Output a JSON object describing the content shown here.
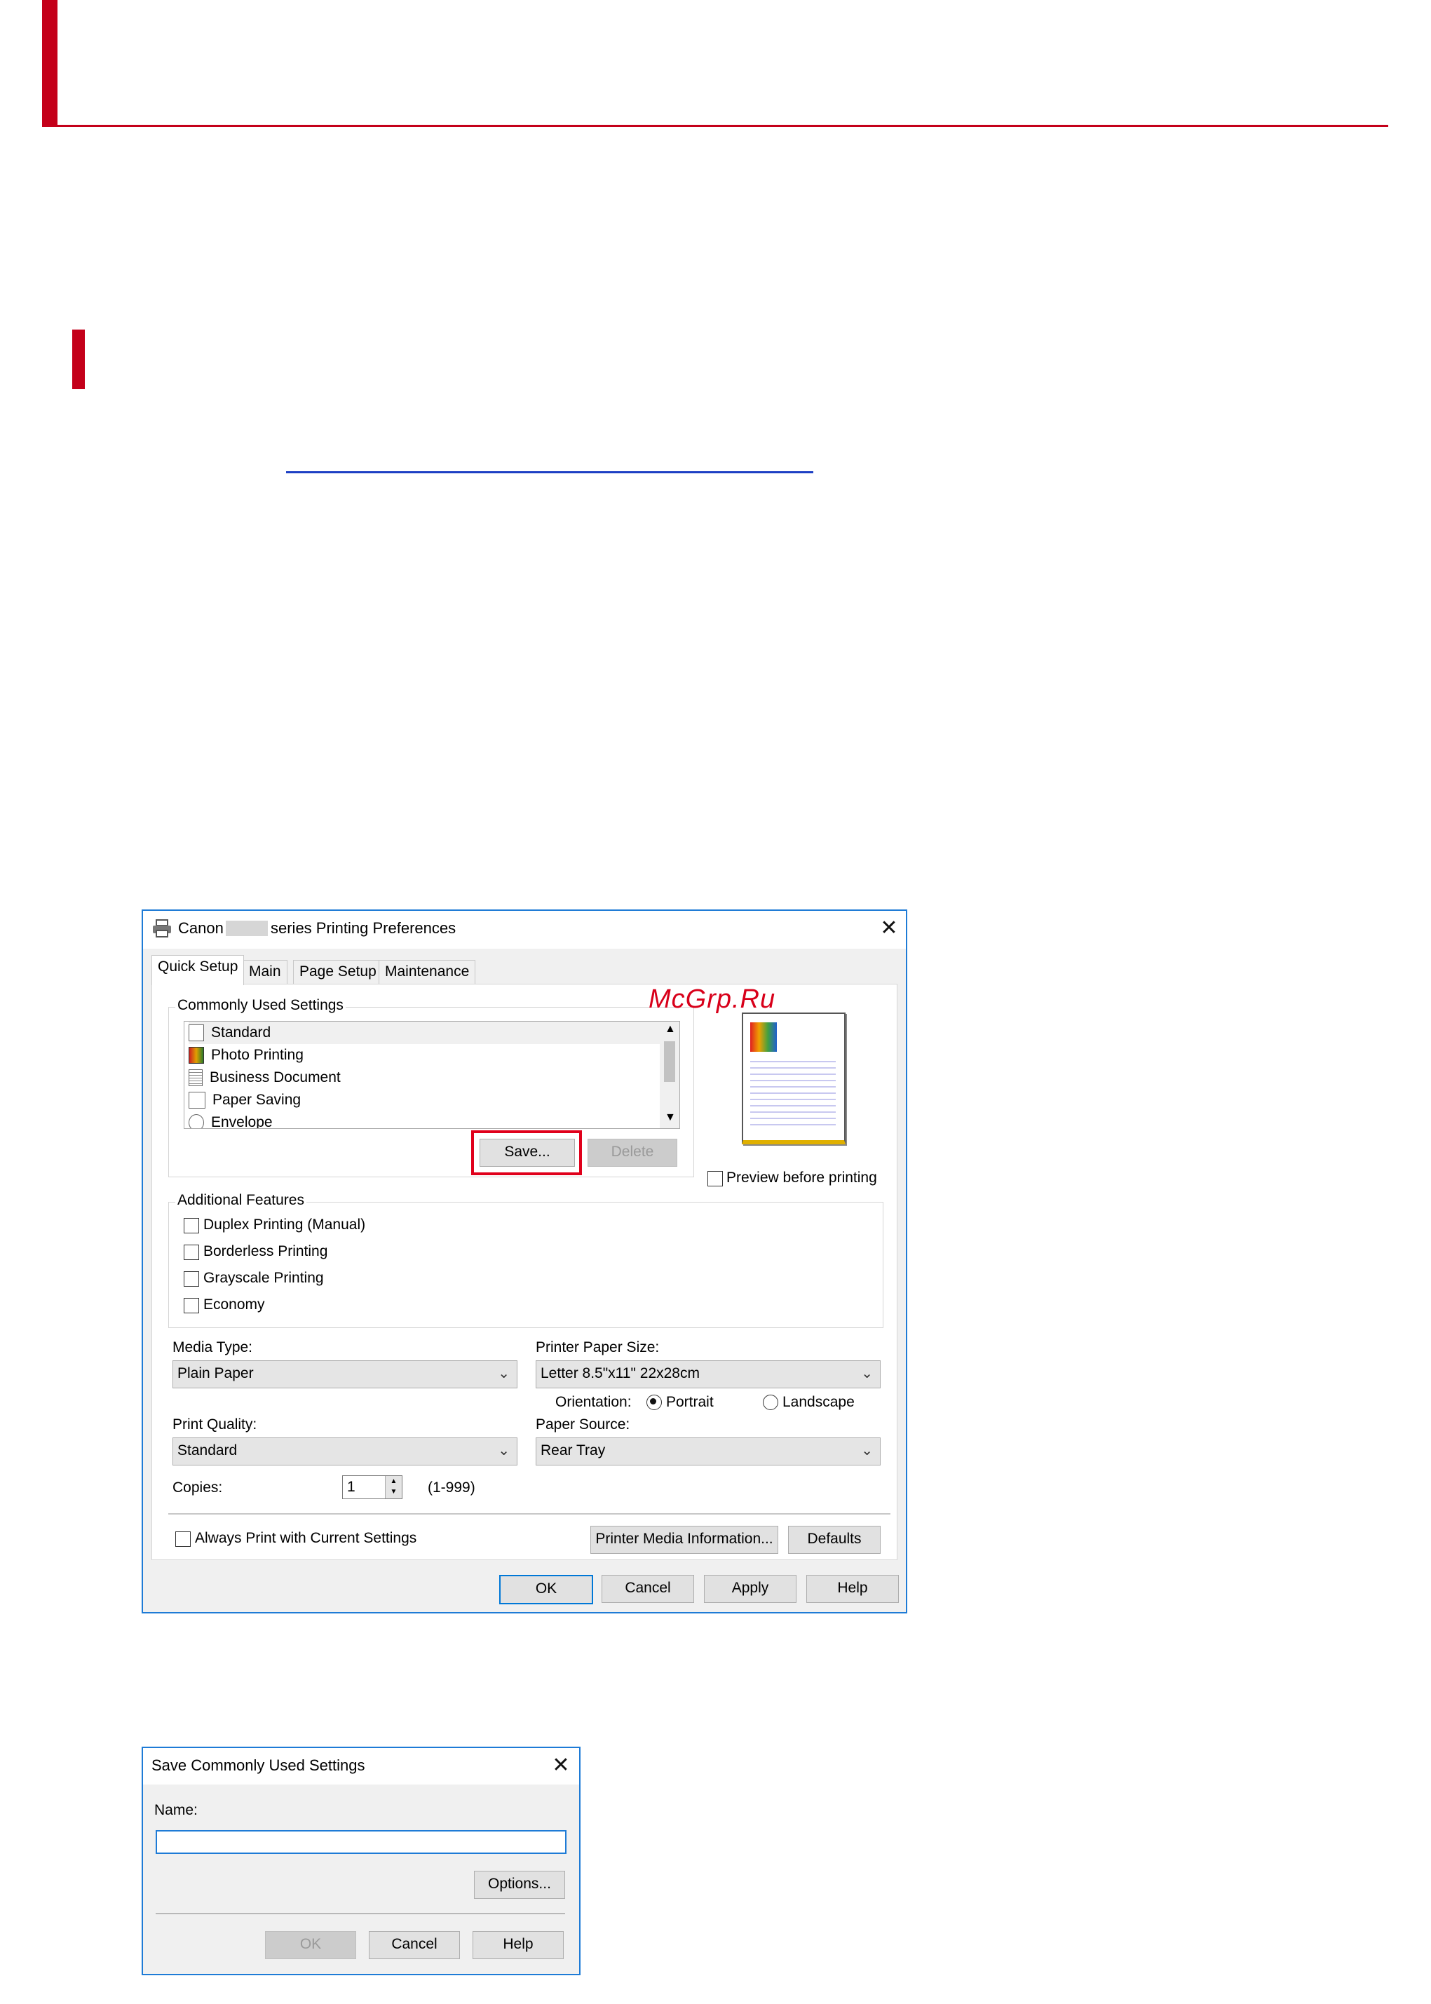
{
  "watermark": "McGrp.Ru",
  "prefs_dialog": {
    "title_prefix": "Canon",
    "title_suffix": "series Printing Preferences",
    "close": "✕",
    "tabs": [
      "Quick Setup",
      "Main",
      "Page Setup",
      "Maintenance"
    ],
    "commonly_used_label": "Commonly Used Settings",
    "list_items": [
      "Standard",
      "Photo Printing",
      "Business Document",
      "Paper Saving",
      "Envelope"
    ],
    "save_button": "Save...",
    "delete_button": "Delete",
    "preview_label": "Preview before printing",
    "additional_features_label": "Additional Features",
    "features": [
      "Duplex Printing (Manual)",
      "Borderless Printing",
      "Grayscale Printing",
      "Economy"
    ],
    "media_type_label": "Media Type:",
    "media_type_value": "Plain Paper",
    "paper_size_label": "Printer Paper Size:",
    "paper_size_value": "Letter 8.5\"x11\" 22x28cm",
    "orientation_label": "Orientation:",
    "portrait_label": "Portrait",
    "landscape_label": "Landscape",
    "print_quality_label": "Print Quality:",
    "print_quality_value": "Standard",
    "paper_source_label": "Paper Source:",
    "paper_source_value": "Rear Tray",
    "copies_label": "Copies:",
    "copies_value": "1",
    "copies_range": "(1-999)",
    "always_print_label": "Always Print with Current Settings",
    "media_info_button": "Printer Media Information...",
    "defaults_button": "Defaults",
    "ok": "OK",
    "cancel": "Cancel",
    "apply": "Apply",
    "help": "Help"
  },
  "save_dialog": {
    "title": "Save Commonly Used Settings",
    "close": "✕",
    "name_label": "Name:",
    "name_value": "",
    "options_button": "Options...",
    "ok": "OK",
    "cancel": "Cancel",
    "help": "Help"
  },
  "colors": {
    "accent_red": "#c4001a",
    "link_blue": "#1d3fc4",
    "highlight_red": "#e0001b",
    "dialog_border": "#1e7bd6"
  }
}
